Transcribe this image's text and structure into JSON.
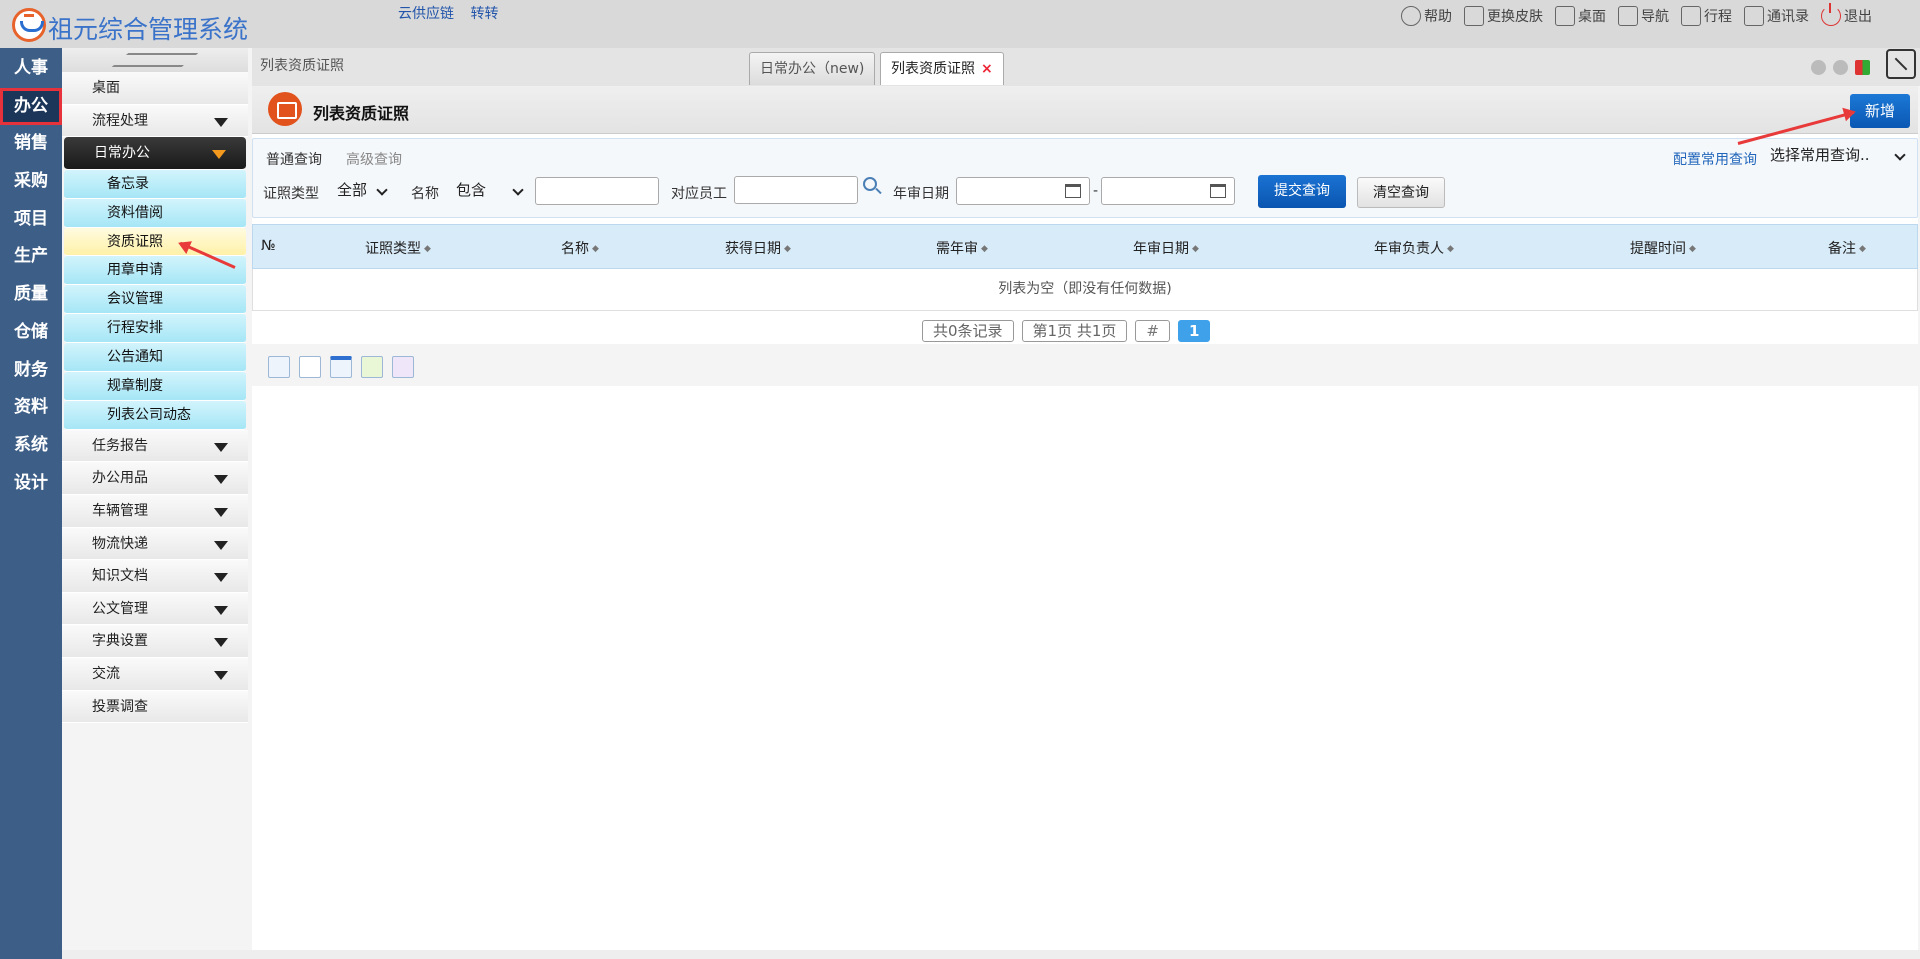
{
  "header": {
    "app_title": "祖元综合管理系统",
    "links": [
      "云供应链",
      "转转"
    ],
    "actions": [
      {
        "icon": "help-icon",
        "label": "帮助"
      },
      {
        "icon": "shirt-icon",
        "label": "更换皮肤"
      },
      {
        "icon": "home-icon",
        "label": "桌面"
      },
      {
        "icon": "grid-icon",
        "label": "导航"
      },
      {
        "icon": "calendar-icon",
        "label": "行程"
      },
      {
        "icon": "contact-icon",
        "label": "通讯录"
      },
      {
        "icon": "power-icon",
        "label": "退出"
      }
    ]
  },
  "leftnav": [
    "人事",
    "办公",
    "销售",
    "采购",
    "项目",
    "生产",
    "质量",
    "仓储",
    "财务",
    "资料",
    "系统",
    "设计"
  ],
  "leftnav_active": "办公",
  "submenu": {
    "desktop": "桌面",
    "flow": "流程处理",
    "daily": "日常办公",
    "daily_items": [
      "备忘录",
      "资料借阅",
      "资质证照",
      "用章申请",
      "会议管理",
      "行程安排",
      "公告通知",
      "规章制度",
      "列表公司动态"
    ],
    "active_item": "资质证照",
    "groups": [
      "任务报告",
      "办公用品",
      "车辆管理",
      "物流快递",
      "知识文档",
      "公文管理",
      "字典设置",
      "交流"
    ],
    "vote": "投票调查"
  },
  "tabsbar": {
    "breadcrumb": "列表资质证照",
    "tabs": [
      "日常办公（new)",
      "列表资质证照"
    ],
    "close_glyph": "×"
  },
  "page": {
    "title": "列表资质证照",
    "new_button": "新增"
  },
  "search": {
    "tab_normal": "普通查询",
    "tab_advanced": "高级查询",
    "config_link": "配置常用查询",
    "common_query": "选择常用查询..",
    "cert_type_label": "证照类型",
    "cert_type_value": "全部",
    "name_label": "名称",
    "name_op": "包含",
    "name_value": "",
    "employee_label": "对应员工",
    "employee_value": "",
    "annual_date_label": "年审日期",
    "date_from": "",
    "date_sep": "-",
    "date_to": "",
    "submit": "提交查询",
    "clear": "清空查询"
  },
  "table": {
    "columns": [
      "№",
      "证照类型",
      "名称",
      "获得日期",
      "需年审",
      "年审日期",
      "年审负责人",
      "提醒时间",
      "备注"
    ],
    "empty_text": "列表为空（即没有任何数据)"
  },
  "pager": {
    "total": "共0条记录",
    "pages": "第1页 共1页",
    "hash": "#",
    "current": "1"
  },
  "colors": {
    "accent": "#0a58b3",
    "nav": "#3d5e87",
    "active_highlight": "#e6333b"
  }
}
